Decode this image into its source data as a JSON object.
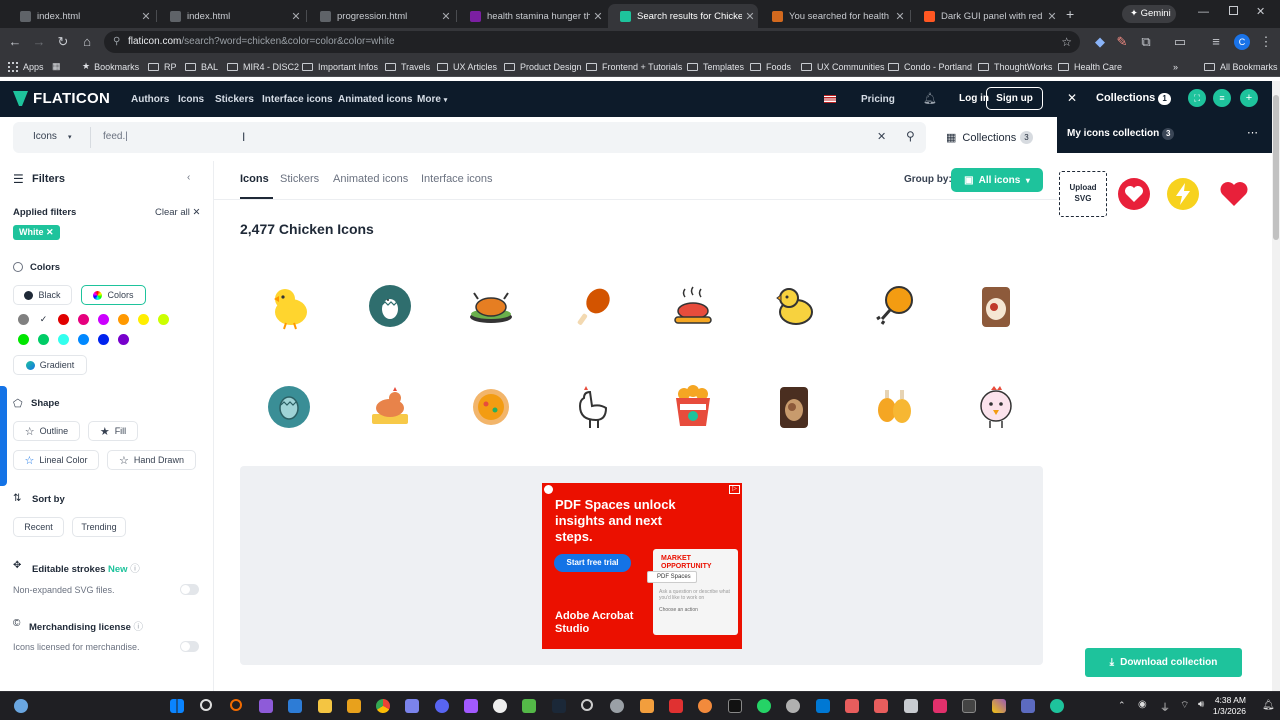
{
  "browser": {
    "tabs": [
      {
        "title": "index.html",
        "fav": "#5f6368"
      },
      {
        "title": "index.html",
        "fav": "#5f6368"
      },
      {
        "title": "progression.html",
        "fav": "#5f6368"
      },
      {
        "title": "health stamina hunger thirst",
        "fav": "#7b1fa2"
      },
      {
        "title": "Search results for Chicken - F",
        "fav": "#1ec39c"
      },
      {
        "title": "You searched for health - Cra",
        "fav": "#d2691e"
      },
      {
        "title": "Dark GUI panel with red HEA",
        "fav": "#ff5722"
      }
    ],
    "gemini_label": "Gemini",
    "url_host": "flaticon.com",
    "url_path": "/search?word=chicken&color=color&color=white",
    "bookmarks": [
      "Apps",
      "Bookmarks",
      "RP",
      "BAL",
      "MIR4 - DISC2",
      "Important Infos",
      "Travels",
      "UX Articles",
      "Product Design",
      "Frontend + Tutorials",
      "Templates",
      "Foods",
      "UX Communities",
      "Condo - Portland",
      "ThoughtWorks",
      "Health Care"
    ],
    "all_bookmarks": "All Bookmarks"
  },
  "header": {
    "logo": "FLATICON",
    "nav": [
      "Authors",
      "Icons",
      "Stickers",
      "Interface icons",
      "Animated icons",
      "More"
    ],
    "pricing": "Pricing",
    "login": "Log in",
    "signup": "Sign up"
  },
  "search": {
    "type": "Icons",
    "value": "feed.|",
    "collections_label": "Collections",
    "collections_count": "3"
  },
  "filters": {
    "title": "Filters",
    "applied_label": "Applied filters",
    "clear_all": "Clear all",
    "chip": "White",
    "colors_title": "Colors",
    "black": "Black",
    "colors": "Colors",
    "gradient": "Gradient",
    "swatches": [
      "#808080",
      "#ffffff",
      "#e00000",
      "#e6007e",
      "#cc00ff",
      "#ff9900",
      "#ffee00",
      "#ccff00",
      "#00e600",
      "#00cc66",
      "#33ffee",
      "#0088ff",
      "#0022ee",
      "#7700cc"
    ],
    "shape_title": "Shape",
    "outline": "Outline",
    "fill": "Fill",
    "lineal": "Lineal Color",
    "hand": "Hand Drawn",
    "sort_title": "Sort by",
    "recent": "Recent",
    "trending": "Trending",
    "editable_title": "Editable strokes",
    "new_badge": "New",
    "editable_desc": "Non-expanded SVG files.",
    "merch_title": "Merchandising license",
    "merch_desc": "Icons licensed for merchandise."
  },
  "main": {
    "tabs": [
      "Icons",
      "Stickers",
      "Animated icons",
      "Interface icons"
    ],
    "group_by": "Group by:",
    "group_value": "All icons",
    "count": "2,477 Chicken Icons",
    "icons": [
      "chick",
      "hatching-egg",
      "roast-chicken-platter",
      "drumstick",
      "roast-chicken-steam",
      "chick-outline",
      "drumstick-orange",
      "chicken-feed-bag",
      "egg-badge",
      "hen-nest",
      "chicken-soup",
      "hen-outline",
      "fried-chicken-bucket",
      "feed-sack",
      "fried-chicken-legs",
      "chicken-face"
    ]
  },
  "ad": {
    "headline": "PDF Spaces unlock insights and next steps.",
    "cta": "Start free trial",
    "brand": "Adobe Acrobat Studio",
    "card_title": "MARKET OPPORTUNITY",
    "card_label": "PDF Spaces",
    "card_sub": "Ask a question or describe what you'd like to work on",
    "card_action": "Choose an action"
  },
  "collections": {
    "title": "Collections",
    "count": "1",
    "my": "My icons collection",
    "my_count": "3",
    "upload": "Upload SVG",
    "download": "Download collection"
  },
  "taskbar": {
    "time": "4:38 AM",
    "date": "1/3/2026"
  }
}
